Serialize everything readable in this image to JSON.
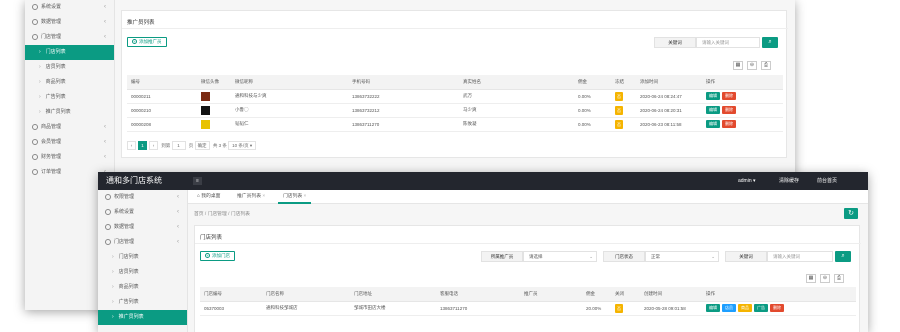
{
  "w1": {
    "sidebar": [
      {
        "label": "系统设置",
        "type": "main"
      },
      {
        "label": "数据管理",
        "type": "main"
      },
      {
        "label": "门店管理",
        "type": "main"
      },
      {
        "label": "门店列表",
        "type": "sub",
        "active": true
      },
      {
        "label": "店员列表",
        "type": "sub"
      },
      {
        "label": "商品列表",
        "type": "sub"
      },
      {
        "label": "广告列表",
        "type": "sub"
      },
      {
        "label": "推广员列表",
        "type": "sub"
      },
      {
        "label": "商品管理",
        "type": "main"
      },
      {
        "label": "会员管理",
        "type": "main"
      },
      {
        "label": "财务管理",
        "type": "main"
      },
      {
        "label": "订单管理",
        "type": "main"
      }
    ],
    "panel_title": "推广员列表",
    "add_btn": "添加推广员",
    "keyword_label": "关键词",
    "keyword_placeholder": "请输入关键词",
    "columns": [
      "编号",
      "微信头像",
      "微信昵称",
      "手机号码",
      "真实姓名",
      "佣金",
      "冻结",
      "添加时间",
      "操作"
    ],
    "rows": [
      {
        "id": "00000211",
        "nick": "通和科技与少爽",
        "phone": "13863732222",
        "name": "武万",
        "comm": "0.00%",
        "frozen": "否",
        "time": "2020-06-24 08:24:47",
        "av": "dark"
      },
      {
        "id": "00000210",
        "nick": "小鲁◯",
        "phone": "13863732212",
        "name": "马少爽",
        "comm": "0.00%",
        "frozen": "否",
        "time": "2020-06-24 08:20:31",
        "av": "black"
      },
      {
        "id": "00000208",
        "nick": "韬韬仁",
        "phone": "13863711270",
        "name": "陈攸凝",
        "comm": "0.00%",
        "frozen": "否",
        "time": "2020-06-23 08:11:58",
        "av": "yellow"
      }
    ],
    "actions": {
      "edit": "编辑",
      "del": "删除"
    },
    "pager": {
      "prev": "‹",
      "page": "1",
      "next": "›",
      "goto": "到第",
      "page_val": "1",
      "page_unit": "页",
      "confirm": "确定",
      "total": "共 3 条",
      "size": "10 条/页"
    }
  },
  "w2": {
    "brand": "通和多门店系统",
    "admin": "admin",
    "clear_cache": "清除缓存",
    "front": "前台首页",
    "tabs": [
      "我的桌面",
      "推广员列表",
      "门店列表"
    ],
    "crumbs": "首页  /  门店管理  /  门店列表",
    "sidebar": [
      {
        "label": "权限管理",
        "type": "main"
      },
      {
        "label": "系统设置",
        "type": "main"
      },
      {
        "label": "数据管理",
        "type": "main"
      },
      {
        "label": "门店管理",
        "type": "main"
      },
      {
        "label": "门店列表",
        "type": "sub"
      },
      {
        "label": "店员列表",
        "type": "sub"
      },
      {
        "label": "商品列表",
        "type": "sub"
      },
      {
        "label": "广告列表",
        "type": "sub"
      },
      {
        "label": "推广员列表",
        "type": "sub",
        "active": true
      }
    ],
    "panel_title": "门店列表",
    "add_btn": "添加门店",
    "filter": {
      "promoter_label": "所属推广员",
      "promoter_val": "请选择",
      "status_label": "门店状态",
      "status_val": "正常",
      "keyword_label": "关键词",
      "keyword_placeholder": "请输入关键词"
    },
    "columns": [
      "门店编号",
      "门店名称",
      "门店地址",
      "客服电话",
      "推广员",
      "佣金",
      "关闭",
      "创建时间",
      "操作"
    ],
    "rows": [
      {
        "id": "05370003",
        "name": "通和科技邹城店",
        "addr": "邹城市田店大楼",
        "phone": "13863711270",
        "promoter": "",
        "comm": "20.00%",
        "closed": "否",
        "time": "2020-05-28 09:01:58"
      }
    ],
    "actions": {
      "edit": "编辑",
      "staff": "店员",
      "goods": "商品",
      "ad": "广告",
      "del": "删除"
    }
  }
}
